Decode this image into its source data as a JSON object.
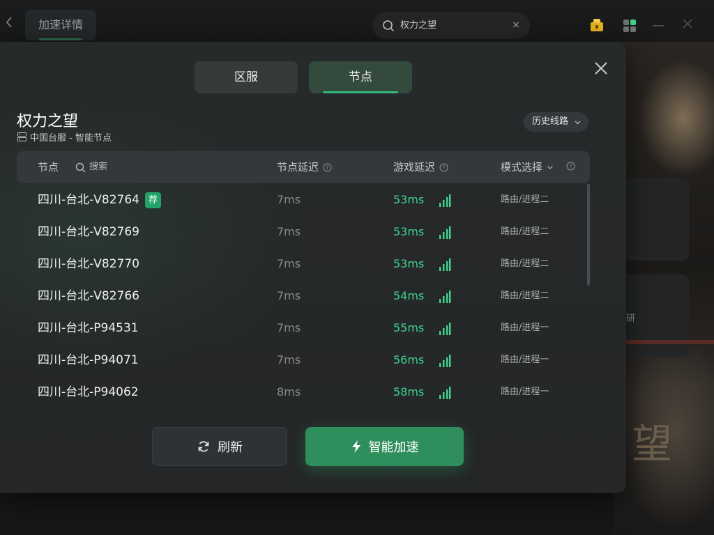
{
  "topbar": {
    "tab_label": "加速详情",
    "search_value": "权力之望",
    "search_clear": "×"
  },
  "background": {
    "partial_text": "研",
    "big_text": "望"
  },
  "modal": {
    "tabs": [
      {
        "label": "区服",
        "active": false
      },
      {
        "label": "节点",
        "active": true
      }
    ],
    "game_title": "权力之望",
    "game_sub": "中国台服 - 智能节点",
    "history_button": "历史线路",
    "headers": {
      "node": "节点",
      "search": "搜索",
      "node_delay": "节点延迟",
      "game_delay": "游戏延迟",
      "mode": "模式选择"
    },
    "rows": [
      {
        "name": "四川-台北-V82764",
        "tag": "荐",
        "node_delay": "7ms",
        "game_delay": "53ms",
        "mode": "路由/进程二"
      },
      {
        "name": "四川-台北-V82769",
        "tag": "",
        "node_delay": "7ms",
        "game_delay": "53ms",
        "mode": "路由/进程二"
      },
      {
        "name": "四川-台北-V82770",
        "tag": "",
        "node_delay": "7ms",
        "game_delay": "53ms",
        "mode": "路由/进程二"
      },
      {
        "name": "四川-台北-V82766",
        "tag": "",
        "node_delay": "7ms",
        "game_delay": "54ms",
        "mode": "路由/进程二"
      },
      {
        "name": "四川-台北-P94531",
        "tag": "",
        "node_delay": "7ms",
        "game_delay": "55ms",
        "mode": "路由/进程一"
      },
      {
        "name": "四川-台北-P94071",
        "tag": "",
        "node_delay": "7ms",
        "game_delay": "56ms",
        "mode": "路由/进程一"
      },
      {
        "name": "四川-台北-P94062",
        "tag": "",
        "node_delay": "8ms",
        "game_delay": "58ms",
        "mode": "路由/进程一"
      }
    ],
    "refresh_button": "刷新",
    "boost_button": "智能加速"
  },
  "colors": {
    "accent_green": "#3fd08c",
    "boost_button": "#2e8f5c",
    "recommend_tag": "#23a36a"
  },
  "icons": [
    "back-icon",
    "search-icon",
    "clear-icon",
    "gift-icon",
    "grid-icon",
    "minimize-icon",
    "close-icon",
    "server-icon",
    "chevron-down-icon",
    "help-icon",
    "signal-icon",
    "refresh-icon",
    "lightning-icon"
  ]
}
